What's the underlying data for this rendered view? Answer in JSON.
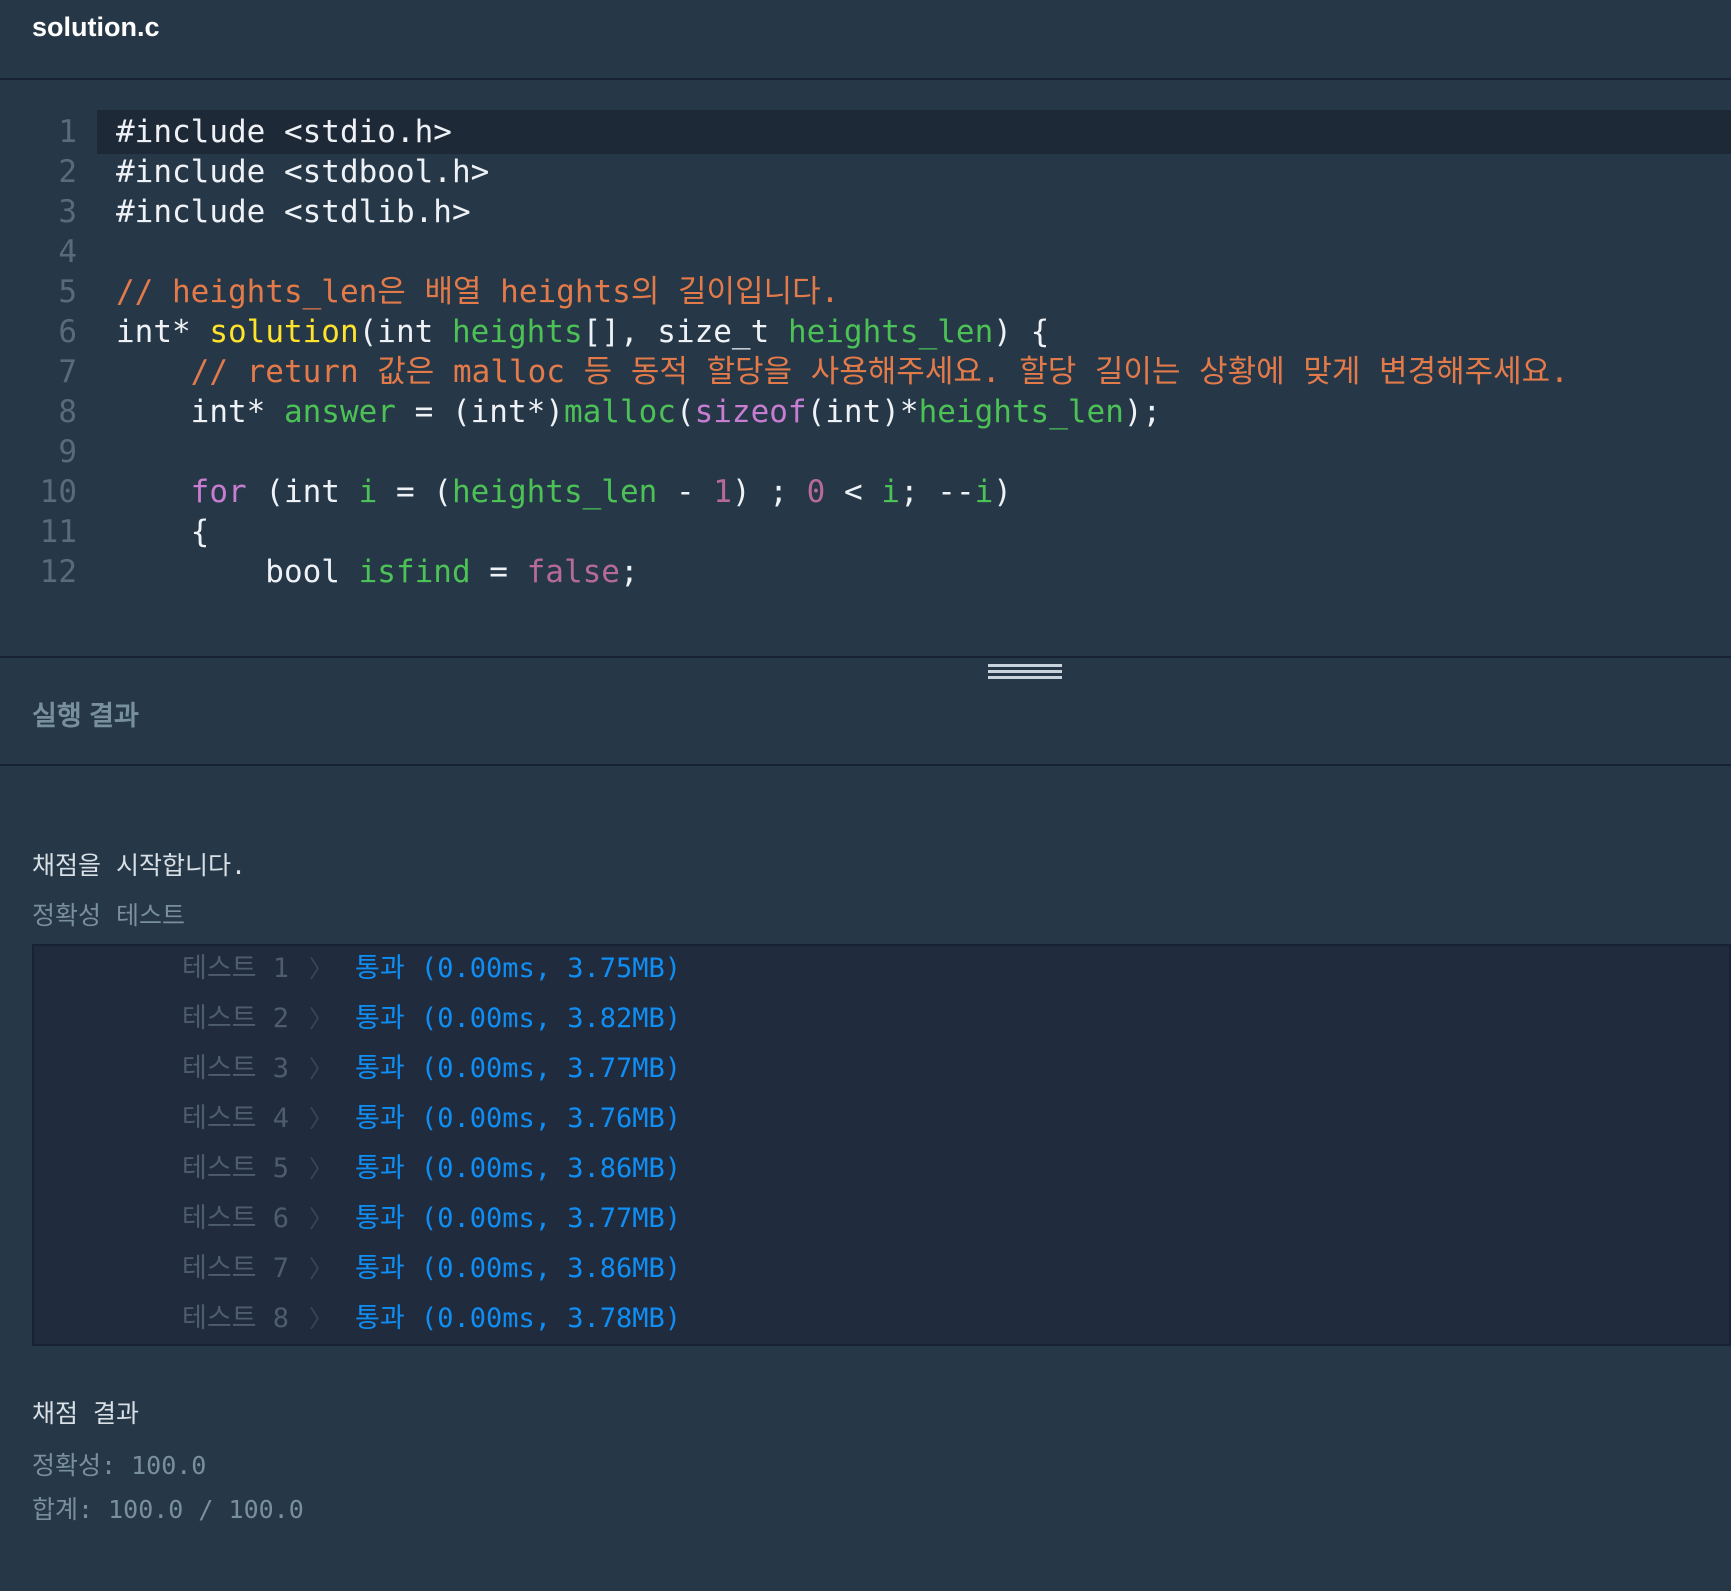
{
  "file": {
    "name": "solution.c"
  },
  "editor": {
    "lines": [
      [
        {
          "t": "#include <stdio.h>",
          "c": "plain"
        }
      ],
      [
        {
          "t": "#include <stdbool.h>",
          "c": "plain"
        }
      ],
      [
        {
          "t": "#include <stdlib.h>",
          "c": "plain"
        }
      ],
      [],
      [
        {
          "t": "// heights_len은 배열 heights의 길이입니다.",
          "c": "comment"
        }
      ],
      [
        {
          "t": "int* ",
          "c": "plain"
        },
        {
          "t": "solution",
          "c": "func"
        },
        {
          "t": "(int ",
          "c": "plain"
        },
        {
          "t": "heights",
          "c": "var"
        },
        {
          "t": "[], size_t ",
          "c": "plain"
        },
        {
          "t": "heights_len",
          "c": "var"
        },
        {
          "t": ") {",
          "c": "plain"
        }
      ],
      [
        {
          "t": "    // return 값은 malloc 등 동적 할당을 사용해주세요. 할당 길이는 상황에 맞게 변경해주세요.",
          "c": "comment"
        }
      ],
      [
        {
          "t": "    int* ",
          "c": "plain"
        },
        {
          "t": "answer",
          "c": "var"
        },
        {
          "t": " = (int*)",
          "c": "plain"
        },
        {
          "t": "malloc",
          "c": "var"
        },
        {
          "t": "(",
          "c": "plain"
        },
        {
          "t": "sizeof",
          "c": "kw"
        },
        {
          "t": "(int)*",
          "c": "plain"
        },
        {
          "t": "heights_len",
          "c": "var"
        },
        {
          "t": ");",
          "c": "plain"
        }
      ],
      [],
      [
        {
          "t": "    ",
          "c": "plain"
        },
        {
          "t": "for",
          "c": "kw"
        },
        {
          "t": " (int ",
          "c": "plain"
        },
        {
          "t": "i",
          "c": "var"
        },
        {
          "t": " = (",
          "c": "plain"
        },
        {
          "t": "heights_len",
          "c": "var"
        },
        {
          "t": " - ",
          "c": "plain"
        },
        {
          "t": "1",
          "c": "num"
        },
        {
          "t": ") ; ",
          "c": "plain"
        },
        {
          "t": "0",
          "c": "num"
        },
        {
          "t": " < ",
          "c": "plain"
        },
        {
          "t": "i",
          "c": "var"
        },
        {
          "t": "; --",
          "c": "plain"
        },
        {
          "t": "i",
          "c": "var"
        },
        {
          "t": ")",
          "c": "plain"
        }
      ],
      [
        {
          "t": "    {",
          "c": "plain"
        }
      ],
      [
        {
          "t": "        bool ",
          "c": "plain"
        },
        {
          "t": "isfind",
          "c": "var"
        },
        {
          "t": " = ",
          "c": "plain"
        },
        {
          "t": "false",
          "c": "num"
        },
        {
          "t": ";",
          "c": "plain"
        }
      ]
    ]
  },
  "result": {
    "title": "실행 결과",
    "start_msg": "채점을 시작합니다.",
    "suite_label": "정확성  테스트",
    "tests": [
      {
        "label": "테스트 1",
        "result": "통과 (0.00ms, 3.75MB)"
      },
      {
        "label": "테스트 2",
        "result": "통과 (0.00ms, 3.82MB)"
      },
      {
        "label": "테스트 3",
        "result": "통과 (0.00ms, 3.77MB)"
      },
      {
        "label": "테스트 4",
        "result": "통과 (0.00ms, 3.76MB)"
      },
      {
        "label": "테스트 5",
        "result": "통과 (0.00ms, 3.86MB)"
      },
      {
        "label": "테스트 6",
        "result": "통과 (0.00ms, 3.77MB)"
      },
      {
        "label": "테스트 7",
        "result": "통과 (0.00ms, 3.86MB)"
      },
      {
        "label": "테스트 8",
        "result": "통과 (0.00ms, 3.78MB)"
      }
    ],
    "score_title": "채점 결과",
    "accuracy": "정확성: 100.0",
    "total": "합계: 100.0 / 100.0"
  },
  "colors": {
    "background": "#263747",
    "comment": "#e37a4a",
    "function": "#ffe32b",
    "variable": "#4cc156",
    "keyword": "#c77dd1",
    "pass": "#0f8ff5"
  }
}
